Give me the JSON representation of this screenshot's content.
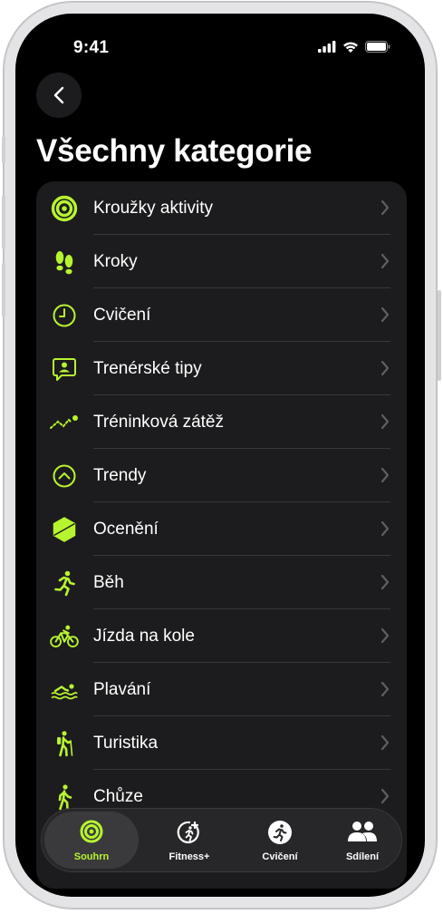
{
  "status_bar": {
    "time": "9:41"
  },
  "header": {
    "back_icon": "chevron-left-icon",
    "title": "Všechny kategorie"
  },
  "categories": [
    {
      "label": "Kroužky aktivity",
      "icon": "activity-rings-icon"
    },
    {
      "label": "Kroky",
      "icon": "footprints-icon"
    },
    {
      "label": "Cvičení",
      "icon": "clock-icon"
    },
    {
      "label": "Trenérské tipy",
      "icon": "coach-tips-icon"
    },
    {
      "label": "Tréninková zátěž",
      "icon": "training-load-icon"
    },
    {
      "label": "Trendy",
      "icon": "trends-icon"
    },
    {
      "label": "Ocenění",
      "icon": "awards-icon"
    },
    {
      "label": "Běh",
      "icon": "running-icon"
    },
    {
      "label": "Jízda na kole",
      "icon": "cycling-icon"
    },
    {
      "label": "Plavání",
      "icon": "swimming-icon"
    },
    {
      "label": "Turistika",
      "icon": "hiking-icon"
    },
    {
      "label": "Chůze",
      "icon": "walking-icon"
    }
  ],
  "tabbar": {
    "tabs": [
      {
        "label": "Souhrn",
        "icon": "summary-rings-icon",
        "active": true
      },
      {
        "label": "Fitness+",
        "icon": "fitness-plus-icon",
        "active": false
      },
      {
        "label": "Cvičení",
        "icon": "workout-icon",
        "active": false
      },
      {
        "label": "Sdílení",
        "icon": "sharing-icon",
        "active": false
      }
    ]
  },
  "colors": {
    "accent": "#b7f430",
    "background": "#000000",
    "card": "#1c1c1e",
    "separator": "#38383a",
    "chevron": "#5f5f63"
  }
}
